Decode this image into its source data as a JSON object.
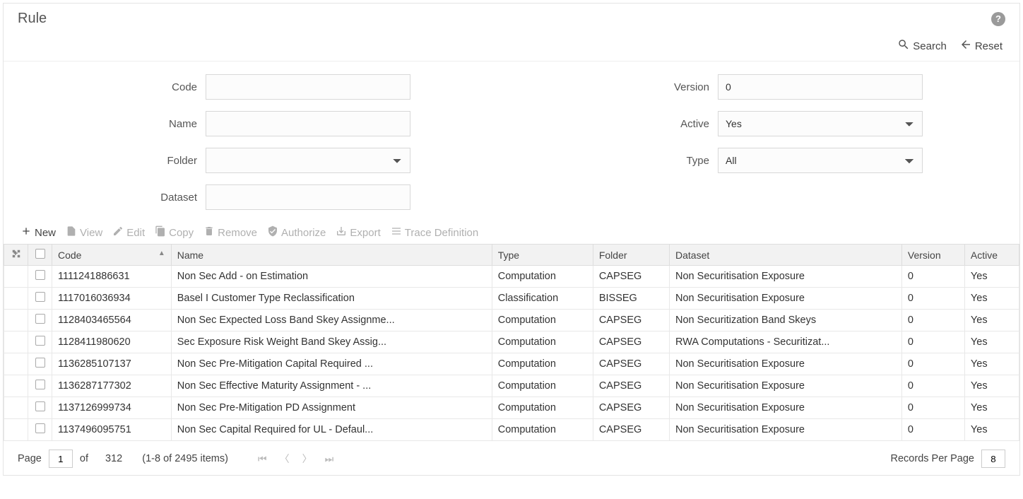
{
  "header": {
    "title": "Rule"
  },
  "topActions": {
    "search": "Search",
    "reset": "Reset"
  },
  "filters": {
    "code_label": "Code",
    "code_value": "",
    "name_label": "Name",
    "name_value": "",
    "folder_label": "Folder",
    "folder_value": "",
    "dataset_label": "Dataset",
    "dataset_value": "",
    "version_label": "Version",
    "version_value": "0",
    "active_label": "Active",
    "active_value": "Yes",
    "type_label": "Type",
    "type_value": "All"
  },
  "toolbar": {
    "new": "New",
    "view": "View",
    "edit": "Edit",
    "copy": "Copy",
    "remove": "Remove",
    "authorize": "Authorize",
    "export": "Export",
    "trace": "Trace Definition"
  },
  "columns": {
    "code": "Code",
    "name": "Name",
    "type": "Type",
    "folder": "Folder",
    "dataset": "Dataset",
    "version": "Version",
    "active": "Active"
  },
  "rows": [
    {
      "code": "1111241886631",
      "name": "Non Sec Add - on Estimation",
      "type": "Computation",
      "folder": "CAPSEG",
      "dataset": "Non Securitisation Exposure",
      "version": "0",
      "active": "Yes"
    },
    {
      "code": "1117016036934",
      "name": "Basel I Customer Type Reclassification",
      "type": "Classification",
      "folder": "BISSEG",
      "dataset": "Non Securitisation Exposure",
      "version": "0",
      "active": "Yes"
    },
    {
      "code": "1128403465564",
      "name": "Non Sec Expected Loss Band Skey Assignme...",
      "type": "Computation",
      "folder": "CAPSEG",
      "dataset": "Non Securitization Band Skeys",
      "version": "0",
      "active": "Yes"
    },
    {
      "code": "1128411980620",
      "name": "Sec Exposure Risk Weight Band Skey Assig...",
      "type": "Computation",
      "folder": "CAPSEG",
      "dataset": "RWA Computations - Securitizat...",
      "version": "0",
      "active": "Yes"
    },
    {
      "code": "1136285107137",
      "name": "Non Sec Pre-Mitigation Capital Required ...",
      "type": "Computation",
      "folder": "CAPSEG",
      "dataset": "Non Securitisation Exposure",
      "version": "0",
      "active": "Yes"
    },
    {
      "code": "1136287177302",
      "name": "Non Sec Effective Maturity Assignment - ...",
      "type": "Computation",
      "folder": "CAPSEG",
      "dataset": "Non Securitisation Exposure",
      "version": "0",
      "active": "Yes"
    },
    {
      "code": "1137126999734",
      "name": "Non Sec Pre-Mitigation PD Assignment",
      "type": "Computation",
      "folder": "CAPSEG",
      "dataset": "Non Securitisation Exposure",
      "version": "0",
      "active": "Yes"
    },
    {
      "code": "1137496095751",
      "name": "Non Sec Capital Required for UL - Defaul...",
      "type": "Computation",
      "folder": "CAPSEG",
      "dataset": "Non Securitisation Exposure",
      "version": "0",
      "active": "Yes"
    }
  ],
  "pager": {
    "page_label": "Page",
    "page_value": "1",
    "of_label": "of",
    "total_pages": "312",
    "range_label": "(1-8 of  2495 items)",
    "rpp_label": "Records Per Page",
    "rpp_value": "8"
  }
}
